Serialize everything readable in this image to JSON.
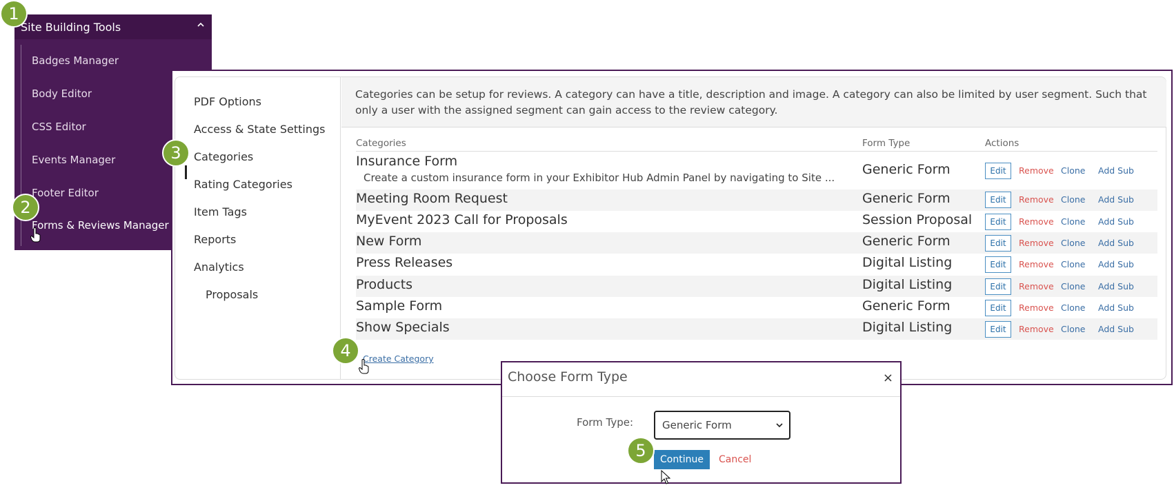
{
  "sidebar": {
    "title": "Site Building Tools",
    "items": [
      {
        "label": "Badges Manager"
      },
      {
        "label": "Body Editor"
      },
      {
        "label": "CSS Editor"
      },
      {
        "label": "Events Manager"
      },
      {
        "label": "Footer Editor"
      },
      {
        "label": "Forms & Reviews Manager"
      }
    ]
  },
  "badges": [
    "1",
    "2",
    "3",
    "4",
    "5"
  ],
  "left_nav": {
    "items": [
      {
        "label": "PDF Options"
      },
      {
        "label": "Access & State Settings"
      },
      {
        "label": "Categories"
      },
      {
        "label": "Rating Categories"
      },
      {
        "label": "Item Tags"
      },
      {
        "label": "Reports"
      },
      {
        "label": "Analytics"
      },
      {
        "label": "Proposals"
      }
    ]
  },
  "info": {
    "text": "Categories can be setup for reviews. A category can have a title, description and image. A category can also be limited by user segment. Such that only a user with the assigned segment can gain access to the review category."
  },
  "table": {
    "headers": {
      "categories": "Categories",
      "form_type": "Form Type",
      "actions": "Actions"
    },
    "actions": {
      "edit": "Edit",
      "remove": "Remove",
      "clone": "Clone",
      "add_sub": "Add Sub"
    },
    "rows": [
      {
        "name": "Insurance Form",
        "description": "Create a custom insurance form in your Exhibitor Hub Admin Panel by navigating to Site ...",
        "form_type": "Generic Form"
      },
      {
        "name": "Meeting Room Request",
        "form_type": "Generic Form"
      },
      {
        "name": "MyEvent 2023 Call for Proposals",
        "form_type": "Session Proposal"
      },
      {
        "name": "New Form",
        "form_type": "Generic Form"
      },
      {
        "name": "Press Releases",
        "form_type": "Digital Listing"
      },
      {
        "name": "Products",
        "form_type": "Digital Listing"
      },
      {
        "name": "Sample Form",
        "form_type": "Generic Form"
      },
      {
        "name": "Show Specials",
        "form_type": "Digital Listing"
      }
    ],
    "create_link": "Create Category"
  },
  "modal": {
    "title": "Choose Form Type",
    "close": "×",
    "label": "Form Type:",
    "select_value": "Generic Form",
    "continue": "Continue",
    "cancel": "Cancel"
  },
  "colors": {
    "sidebar_bg": "#4a1b56",
    "badge": "#7da636",
    "primary_button": "#2c7fb8",
    "remove_link": "#d9534f"
  }
}
